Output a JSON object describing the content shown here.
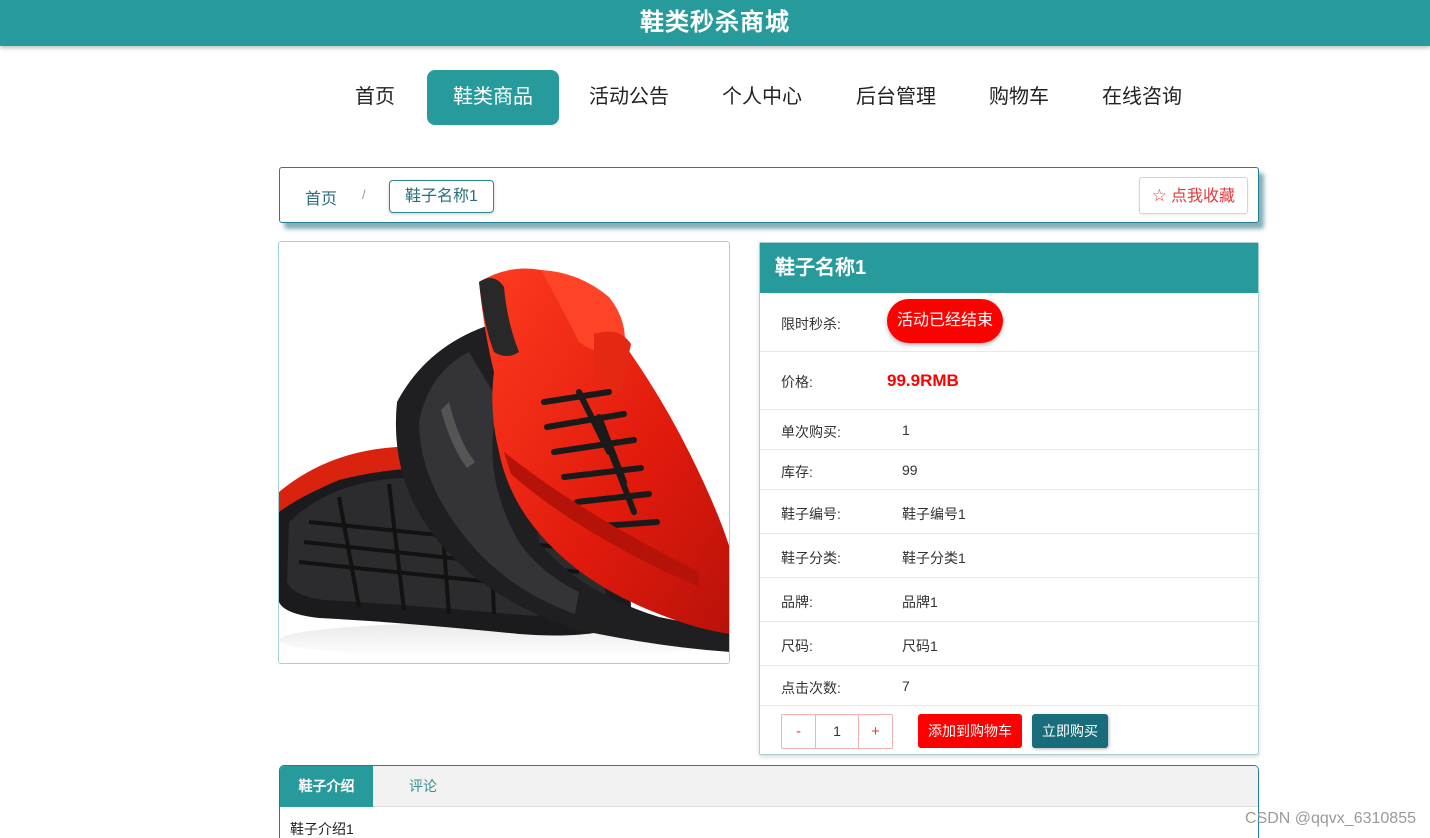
{
  "header": {
    "title": "鞋类秒杀商城"
  },
  "nav": {
    "items": [
      {
        "label": "首页"
      },
      {
        "label": "鞋类商品"
      },
      {
        "label": "活动公告"
      },
      {
        "label": "个人中心"
      },
      {
        "label": "后台管理"
      },
      {
        "label": "购物车"
      },
      {
        "label": "在线咨询"
      }
    ],
    "active_index": 1
  },
  "breadcrumb": {
    "home": "首页",
    "separator": "/",
    "current": "鞋子名称1",
    "favorite_label": "点我收藏",
    "favorite_icon": "star-outline-icon"
  },
  "product": {
    "image_alt": "red running shoe",
    "name": "鞋子名称1",
    "flash_sale_label": "限时秒杀:",
    "flash_sale_status": "活动已经结束",
    "price_label": "价格:",
    "price": "99.9RMB",
    "details": [
      {
        "label": "单次购买:",
        "value": "1"
      },
      {
        "label": "库存:",
        "value": "99"
      },
      {
        "label": "鞋子编号:",
        "value": "鞋子编号1"
      },
      {
        "label": "鞋子分类:",
        "value": "鞋子分类1"
      },
      {
        "label": "品牌:",
        "value": "品牌1"
      },
      {
        "label": "尺码:",
        "value": "尺码1"
      },
      {
        "label": "点击次数:",
        "value": "7"
      }
    ],
    "quantity": {
      "minus": "-",
      "value": "1",
      "plus": "+"
    },
    "add_to_cart": "添加到购物车",
    "buy_now": "立即购买"
  },
  "tabs": {
    "items": [
      {
        "label": "鞋子介绍"
      },
      {
        "label": "评论"
      }
    ],
    "active_index": 0,
    "content": "鞋子介绍1"
  },
  "watermark": "CSDN @qqvx_6310855",
  "colors": {
    "primary": "#279a9c",
    "danger": "#ff0000",
    "dark_teal": "#196d7a"
  }
}
